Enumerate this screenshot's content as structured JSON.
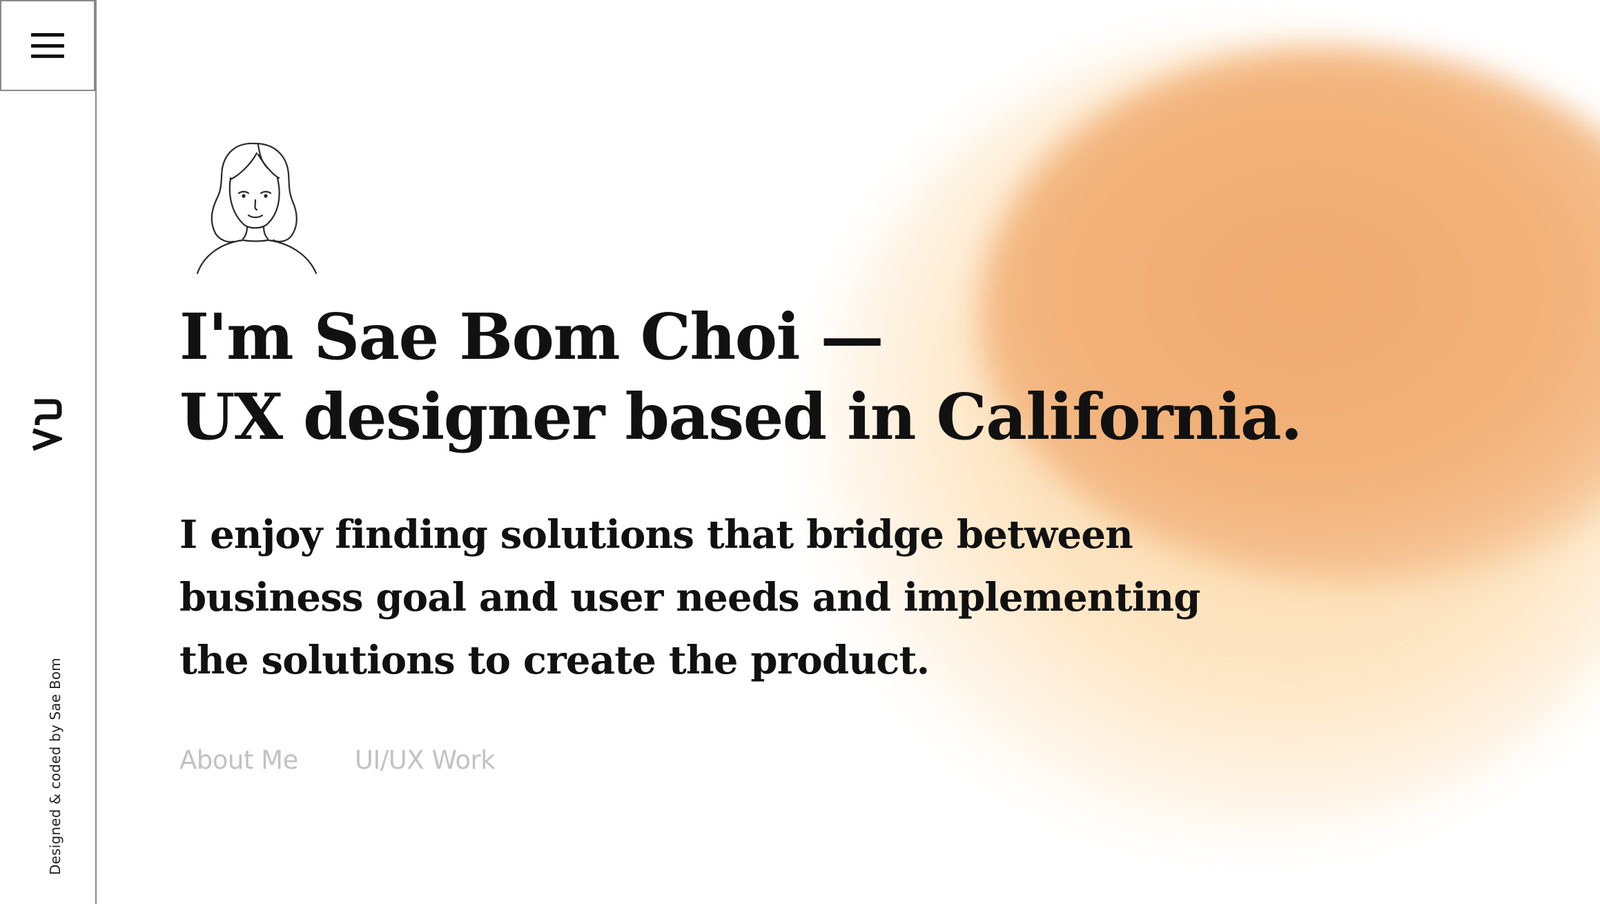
{
  "sidebar": {
    "menu_icon": "hamburger-menu-icon",
    "logo_icon": "sb-monogram-logo",
    "credit": "Designed & coded by Sae Bom"
  },
  "hero": {
    "avatar_icon": "illustrated-avatar-portrait",
    "headline_line1": "I'm Sae Bom Choi —",
    "headline_line2": "UX designer based in California.",
    "intro_line1": "I enjoy finding solutions that bridge between",
    "intro_line2": "business goal and user needs and implementing",
    "intro_line3": "the solutions to create the product."
  },
  "nav": {
    "about_label": "About Me",
    "work_label": "UI/UX Work"
  },
  "colors": {
    "accent_blob": "#f2b27a",
    "blob_light": "#fde6c4",
    "text": "#111111",
    "nav_link": "#c2c2c2",
    "sidebar_border": "#8a8a8a"
  }
}
